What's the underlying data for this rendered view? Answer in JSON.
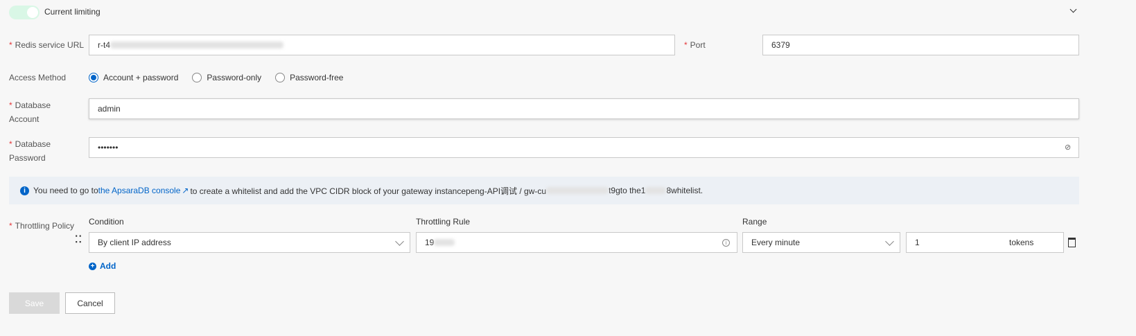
{
  "toggle": {
    "label": "Current limiting",
    "on": true
  },
  "redis": {
    "label": "Redis service URL",
    "value": "r-t4"
  },
  "port": {
    "label": "Port",
    "value": "6379"
  },
  "access": {
    "label": "Access Method",
    "options": [
      "Account + password",
      "Password-only",
      "Password-free"
    ],
    "selected": 0
  },
  "account": {
    "label": "Database Account",
    "value": "admin"
  },
  "password": {
    "label": "Database Password",
    "value": "•••••••"
  },
  "info": {
    "pre": "You need to go to",
    "link": "the ApsaraDB console",
    "mid": "to create a whitelist and add the VPC CIDR block of your gateway instancepeng-API调试 / gw-cu",
    "mid2": "t9gto the1",
    "post": "8whitelist."
  },
  "throttling": {
    "label": "Throttling Policy",
    "col_condition": "Condition",
    "col_rule": "Throttling Rule",
    "col_range": "Range",
    "condition": "By client IP address",
    "rule": "19",
    "range": "Every minute",
    "tokens": "1",
    "tokens_unit": "tokens",
    "add": "Add"
  },
  "buttons": {
    "save": "Save",
    "cancel": "Cancel"
  }
}
